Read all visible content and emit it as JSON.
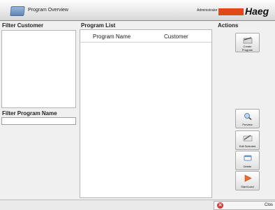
{
  "window": {
    "title": "Program Overview",
    "user": "Administrator",
    "brand": "Haeg"
  },
  "filters": {
    "customer_title": "Filter Customer",
    "program_name_title": "Filter Program Name",
    "program_name_value": ""
  },
  "program_list": {
    "title": "Program List",
    "columns": [
      "Program Name",
      "Customer"
    ],
    "rows": []
  },
  "actions": {
    "title": "Actions",
    "create_line1": "Create",
    "create_line2": "Program",
    "preview": "Preview",
    "edit": "Edit Selected",
    "delete": "Delete",
    "start": "Start/Load"
  },
  "footer": {
    "close": "Clos"
  },
  "colors": {
    "brand": "#e2461f",
    "close": "#dd3333"
  }
}
